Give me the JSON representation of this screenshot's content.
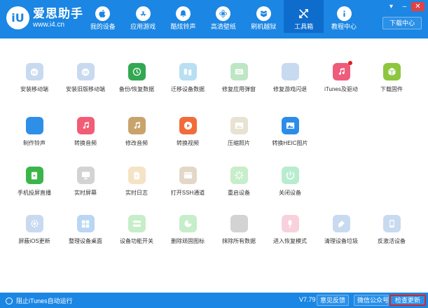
{
  "app": {
    "name": "爱思助手",
    "url": "www.i4.cn",
    "download_center": "下载中心"
  },
  "nav": [
    {
      "label": "我的设备",
      "icon": "apple-icon",
      "active": false
    },
    {
      "label": "应用游戏",
      "icon": "appstore-icon",
      "active": false
    },
    {
      "label": "酷炫铃声",
      "icon": "bell-icon",
      "active": false
    },
    {
      "label": "高清壁纸",
      "icon": "flower-icon",
      "active": false
    },
    {
      "label": "刷机越狱",
      "icon": "box-icon",
      "active": false
    },
    {
      "label": "工具箱",
      "icon": "tools-icon",
      "active": true
    },
    {
      "label": "教程中心",
      "icon": "info-icon",
      "active": false
    }
  ],
  "tools": [
    [
      {
        "label": "安装移动端",
        "icon": "i4-icon",
        "color": "#c8daf0",
        "disabled": true
      },
      {
        "label": "安装旧版移动端",
        "icon": "i4-icon",
        "color": "#c8daf0",
        "disabled": true
      },
      {
        "label": "备份/恢复数据",
        "icon": "backup-icon",
        "color": "#33a852",
        "disabled": false
      },
      {
        "label": "迁移设备数据",
        "icon": "migrate-icon",
        "color": "#b8dff2",
        "disabled": true
      },
      {
        "label": "修复应用弹窗",
        "icon": "keyboard-icon",
        "color": "#bfe6c4",
        "disabled": true
      },
      {
        "label": "修复游戏闪退",
        "icon": "appstore-icon",
        "color": "#c8daf0",
        "disabled": true
      },
      {
        "label": "iTunes及驱动",
        "icon": "music-icon",
        "color": "#ef5b7b",
        "disabled": false,
        "badge": true
      },
      {
        "label": "下载固件",
        "icon": "cube-icon",
        "color": "#8dc63f",
        "disabled": false
      }
    ],
    [
      {
        "label": "制作铃声",
        "icon": "bell-icon",
        "color": "#2d8fe8",
        "disabled": false
      },
      {
        "label": "转换音频",
        "icon": "music-icon",
        "color": "#f25c75",
        "disabled": false
      },
      {
        "label": "修改音频",
        "icon": "audio-edit-icon",
        "color": "#c9a36c",
        "disabled": false
      },
      {
        "label": "转换视频",
        "icon": "play-icon",
        "color": "#f26b3a",
        "disabled": false
      },
      {
        "label": "压缩照片",
        "icon": "photo-icon",
        "color": "#e8e2d3",
        "disabled": true
      },
      {
        "label": "转换HEIC图片",
        "icon": "photo-icon",
        "color": "#2b8de8",
        "disabled": false
      }
    ],
    [
      {
        "label": "手机投屏直播",
        "icon": "cast-icon",
        "color": "#3bb54a",
        "disabled": false
      },
      {
        "label": "实时屏幕",
        "icon": "monitor-icon",
        "color": "#d3d3d3",
        "disabled": true
      },
      {
        "label": "实时日志",
        "icon": "doc-icon",
        "color": "#f5e3c6",
        "disabled": true
      },
      {
        "label": "打开SSH通道",
        "icon": "terminal-icon",
        "color": "#e3d8c8",
        "disabled": true
      },
      {
        "label": "重启设备",
        "icon": "spinner-icon",
        "color": "#c6eec9",
        "disabled": true
      },
      {
        "label": "关闭设备",
        "icon": "power-icon",
        "color": "#b8eccf",
        "disabled": true
      }
    ],
    [
      {
        "label": "屏蔽iOS更新",
        "icon": "gear-icon",
        "color": "#c8daf0",
        "disabled": true
      },
      {
        "label": "整理设备桌面",
        "icon": "grid-icon",
        "color": "#b9d6f2",
        "disabled": true
      },
      {
        "label": "设备功能开关",
        "icon": "toggle-icon",
        "color": "#c6eec9",
        "disabled": true
      },
      {
        "label": "删除顽固图标",
        "icon": "pie-icon",
        "color": "#c6eec9",
        "disabled": true
      },
      {
        "label": "抹除所有数据",
        "icon": "apple-icon",
        "color": "#d3d3d3",
        "disabled": true
      },
      {
        "label": "进入恢复模式",
        "icon": "cable-icon",
        "color": "#f7d2dc",
        "disabled": true
      },
      {
        "label": "清理设备垃圾",
        "icon": "broom-icon",
        "color": "#c8daf0",
        "disabled": true
      },
      {
        "label": "反激活设备",
        "icon": "phone-icon",
        "color": "#c8daf0",
        "disabled": true
      }
    ]
  ],
  "status": {
    "block_itunes": "阻止iTunes自动运行",
    "version": "V7.79",
    "feedback": "意见反馈",
    "wechat": "微信公众号",
    "check_update": "检查更新"
  },
  "colors": {
    "brand": "#1b86e3",
    "nav_active": "#0d6ccc",
    "highlight": "#d92626"
  }
}
